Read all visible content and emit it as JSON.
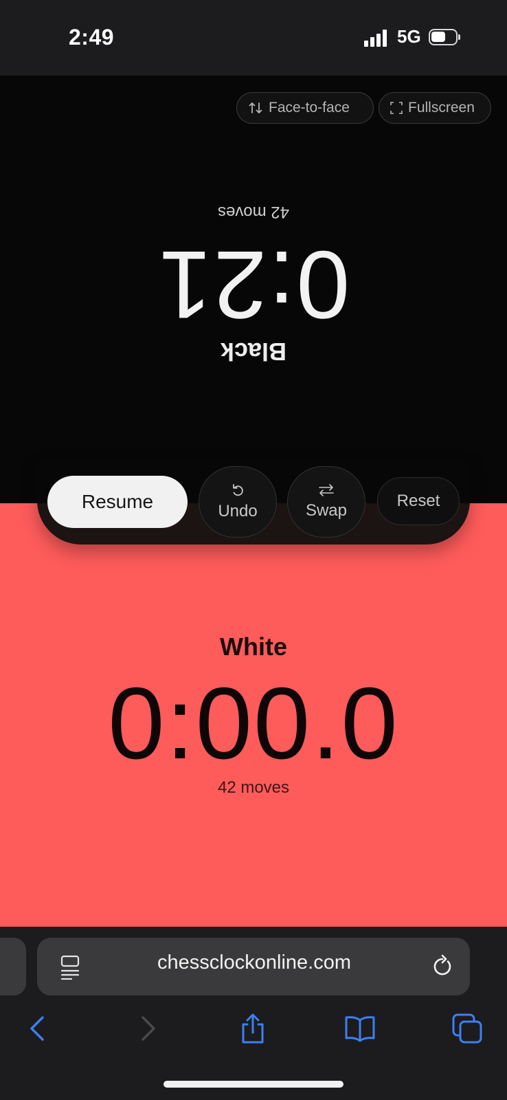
{
  "status_bar": {
    "time": "2:49",
    "network": "5G"
  },
  "toolbar": {
    "face_to_face_label": "Face-to-face",
    "fullscreen_label": "Fullscreen"
  },
  "black": {
    "name": "Black",
    "clock": "0:21",
    "moves": "42 moves"
  },
  "white": {
    "name": "White",
    "clock": "0:00.0",
    "moves": "42 moves"
  },
  "controls": {
    "resume_label": "Resume",
    "undo_label": "Undo",
    "swap_label": "Swap",
    "reset_label": "Reset"
  },
  "browser": {
    "url": "chessclockonline.com"
  },
  "colors": {
    "white_active": "#fe5b5b",
    "black_panel": "#070707",
    "safari_accent": "#3d7ff5"
  },
  "icons": {
    "face_to_face": "arrows-up-down-icon",
    "fullscreen": "fullscreen-corners-icon",
    "undo": "undo-arrow-icon",
    "swap": "swap-arrows-icon",
    "back": "chevron-left-icon",
    "forward": "chevron-right-icon",
    "share": "share-icon",
    "bookmarks": "book-icon",
    "tabs": "tabs-icon"
  }
}
